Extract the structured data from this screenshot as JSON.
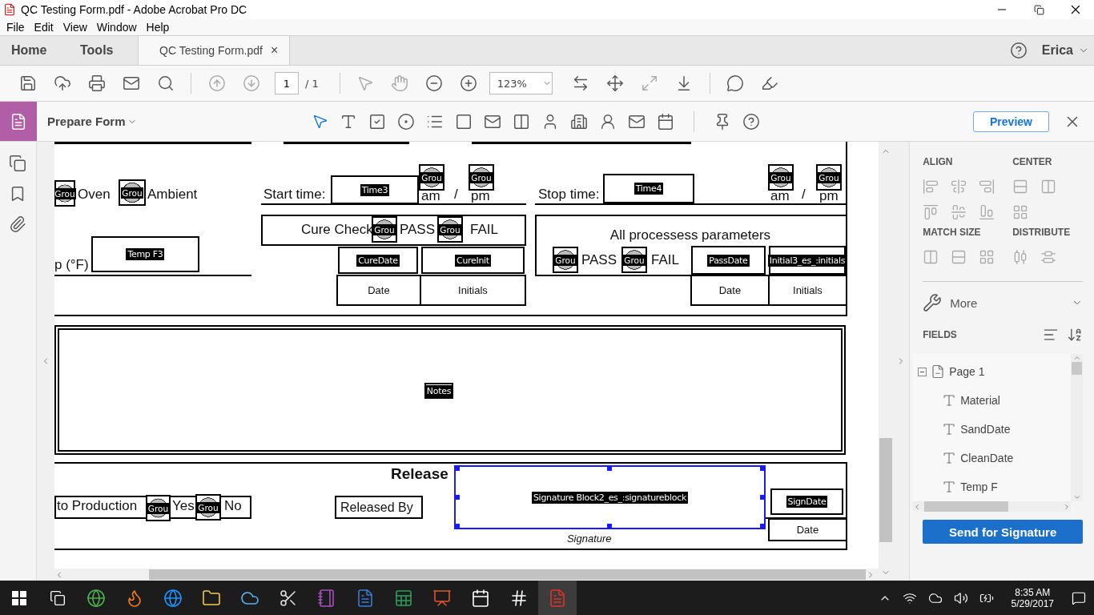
{
  "window": {
    "title": "QC Testing Form.pdf - Adobe Acrobat Pro DC"
  },
  "menu": [
    "File",
    "Edit",
    "View",
    "Window",
    "Help"
  ],
  "tabs": [
    {
      "label": "Home",
      "selected": false
    },
    {
      "label": "Tools",
      "selected": false
    },
    {
      "label": "QC Testing Form.pdf",
      "selected": true,
      "close": "×"
    }
  ],
  "account": {
    "user": "Erica"
  },
  "toolbar": {
    "page": "1",
    "page_count": "/ 1",
    "zoom": "123%"
  },
  "prepare_form": {
    "title": "Prepare Form",
    "preview": "Preview"
  },
  "form": {
    "heat": [
      {
        "field": "Grou",
        "label": "Oven"
      },
      {
        "field": "Grou",
        "label": "Ambient"
      }
    ],
    "temp": {
      "label": "p (°F)",
      "field": "Temp F3"
    },
    "times": [
      {
        "label": "Start time:",
        "field": "Time3",
        "am_field": "Grou",
        "am": "am",
        "slash": "/",
        "pm_field": "Grou",
        "pm": "pm"
      },
      {
        "label": "Stop time:",
        "field": "Time4",
        "am_field": "Grou",
        "am": "am",
        "slash": "/",
        "pm_field": "Grou",
        "pm": "pm"
      }
    ],
    "checks": [
      {
        "label": "Cure Check",
        "pass_field": "Grou",
        "pass": "PASS",
        "fail_field": "Grou",
        "fail": "FAIL",
        "date_field": "CureDate",
        "initials_field": "CureInit",
        "date": "Date",
        "initials": "Initials"
      },
      {
        "label": "All processess parameters",
        "pass_field": "Grou",
        "pass": "PASS",
        "fail_field": "Grou",
        "fail": "FAIL",
        "date_field": "PassDate",
        "initials_field": "Initial3_es_:initials",
        "date": "Date",
        "initials": "Initials"
      }
    ],
    "notes": "Notes",
    "release": {
      "title": "Release",
      "production": "to Production",
      "yes_field": "Grou",
      "yes": "Yes",
      "no_field": "Grou",
      "no": "No",
      "released_by": "Released By",
      "signature_field": "Signature Block2_es_:signatureblock",
      "signature_selected": true,
      "signature": "Signature",
      "date_field": "SignDate",
      "date": "Date"
    }
  },
  "panel": {
    "align": "ALIGN",
    "center": "CENTER",
    "match_size": "MATCH SIZE",
    "distribute": "DISTRIBUTE",
    "more": "More",
    "fields_title": "FIELDS",
    "tree": [
      {
        "label": "Page 1",
        "expanded": true,
        "children": [
          {
            "label": "Material"
          },
          {
            "label": "SandDate"
          },
          {
            "label": "CleanDate"
          },
          {
            "label": "Temp F"
          }
        ]
      }
    ],
    "send": "Send for Signature"
  },
  "taskbar": {
    "time": "8:35 AM",
    "date": "5/29/2017"
  }
}
